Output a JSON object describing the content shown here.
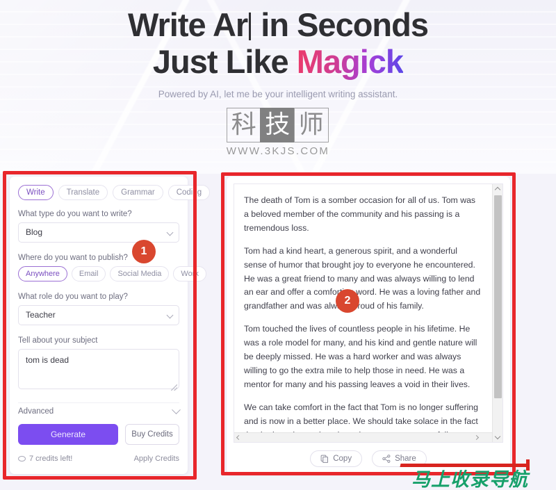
{
  "hero": {
    "headline_line1_pre": "Write Ar",
    "headline_line1_post": " in Seconds",
    "headline_line2_pre": "Just Like ",
    "headline_line2_accent": "Magick",
    "subhead": "Powered by AI, let me be your intelligent writing assistant.",
    "gradient_start": "#ec3b6a",
    "gradient_mid": "#a33fd8",
    "gradient_end": "#5a46e8"
  },
  "logo_watermark": {
    "char1": "科",
    "char2": "技",
    "char3": "师",
    "url": "WWW.3KJS.COM"
  },
  "left_panel": {
    "tabs": [
      {
        "label": "Write",
        "active": true
      },
      {
        "label": "Translate",
        "active": false
      },
      {
        "label": "Grammar",
        "active": false
      },
      {
        "label": "Coding",
        "active": false
      }
    ],
    "type_label": "What type do you want to write?",
    "type_value": "Blog",
    "publish_label": "Where do you want to publish?",
    "publish_pills": [
      {
        "label": "Anywhere",
        "active": true
      },
      {
        "label": "Email",
        "active": false
      },
      {
        "label": "Social Media",
        "active": false
      },
      {
        "label": "Work",
        "active": false
      }
    ],
    "role_label": "What role do you want to play?",
    "role_value": "Teacher",
    "subject_label": "Tell about your subject",
    "subject_value": "tom is dead",
    "subject_placeholder": "Tell about your subject",
    "advanced_label": "Advanced",
    "generate_label": "Generate",
    "buy_credits_label": "Buy Credits",
    "credits_text": "7 credits left!",
    "apply_credits_label": "Apply Credits",
    "accent_color": "#7c4df0"
  },
  "right_panel": {
    "paragraphs": [
      "The death of Tom is a somber occasion for all of us. Tom was a beloved member of the community and his passing is a tremendous loss.",
      "Tom had a kind heart, a generous spirit, and a wonderful sense of humor that brought joy to everyone he encountered. He was a great friend to many and was always willing to lend an ear and offer a comforting word. He was a loving father and grandfather and was always proud of his family.",
      "Tom touched the lives of countless people in his lifetime. He was a role model for many, and his kind and gentle nature will be deeply missed. He was a hard worker and was always willing to go the extra mile to help those in need. He was a mentor for many and his passing leaves a void in their lives.",
      "We can take comfort in the fact that Tom is no longer suffering and is now in a better place. We should take solace in the fact that he is no longer in pain and can now rest peacefully."
    ],
    "copy_label": "Copy",
    "share_label": "Share"
  },
  "annotations": {
    "marker_1": "1",
    "marker_2": "2",
    "box_color": "#e8262b",
    "marker_color": "#d9472f"
  },
  "bottom_watermark": {
    "text": "马上收录导航",
    "green": "#16a06a",
    "red": "#d8241f"
  }
}
